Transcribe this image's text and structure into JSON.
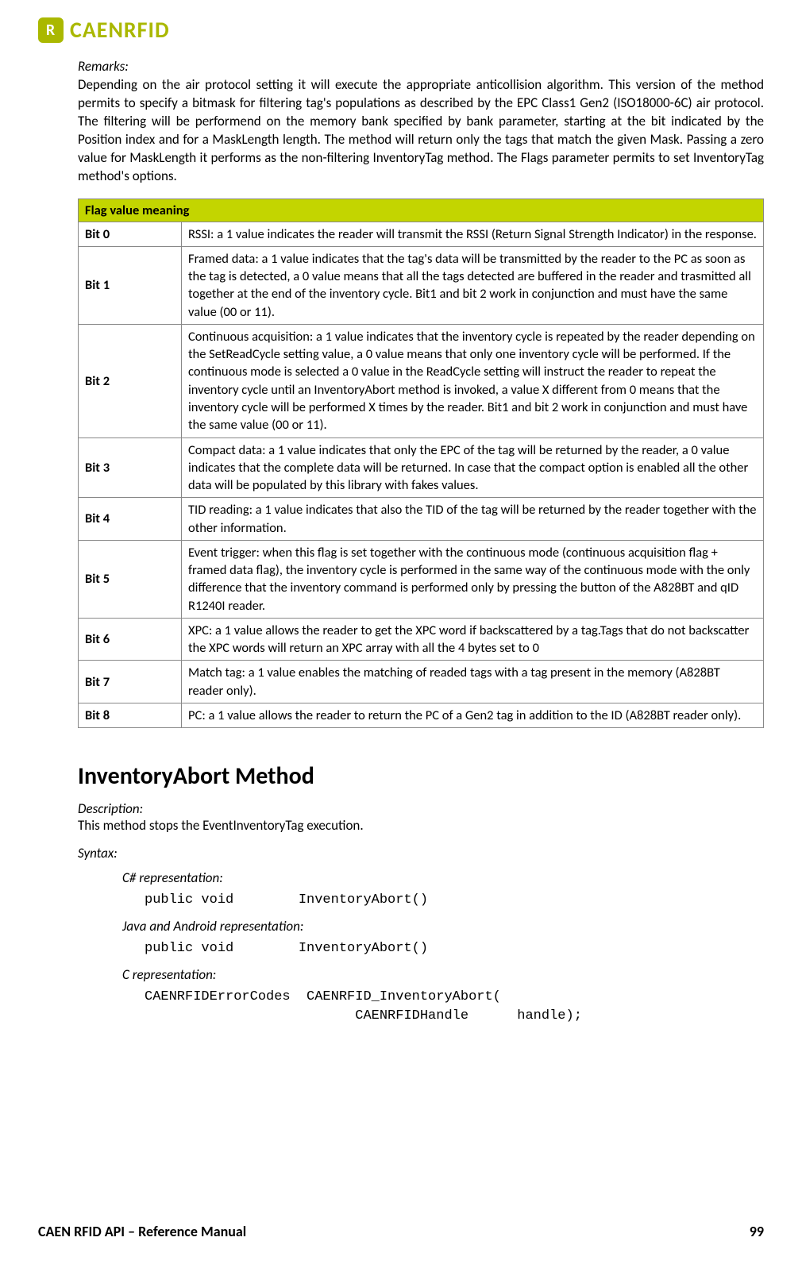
{
  "logo": {
    "text": "CAENRFID"
  },
  "remarks": {
    "label": "Remarks:",
    "text": "Depending on the air protocol setting it will execute the appropriate anticollision algorithm. This version of the method permits to specify a bitmask for filtering tag's populations as described by the EPC Class1 Gen2 (ISO18000-6C) air protocol. The filtering will be performend on the memory bank specified by bank parameter, starting at the bit indicated by the Position index and for a MaskLength length. The method will return only the tags that match the given Mask. Passing a zero value for MaskLength it performs as the non-filtering InventoryTag method. The Flags parameter permits to set InventoryTag method's options."
  },
  "table": {
    "header": "Flag value meaning",
    "rows": [
      {
        "bit": "Bit 0",
        "desc": "RSSI: a 1 value indicates the reader will transmit the RSSI (Return Signal Strength Indicator) in the response."
      },
      {
        "bit": "Bit 1",
        "desc": "Framed data: a 1 value indicates that the tag's data will be transmitted by the reader to the PC as soon as the tag is detected, a 0 value means that all the tags detected are buffered in the reader and trasmitted all together at the end of the inventory cycle.\nBit1 and bit 2 work in conjunction and must have the same value (00 or 11)."
      },
      {
        "bit": "Bit 2",
        "desc": "Continuous acquisition: a 1 value indicates that the inventory cycle is repeated by the reader depending on the SetReadCycle setting value, a 0 value means that only one inventory cycle will be performed. If the continuous mode is selected a 0 value in the ReadCycle setting will instruct the reader to repeat the inventory cycle until an InventoryAbort method is invoked, a value X different from 0 means that the inventory cycle will be performed X times by the reader.\nBit1 and bit 2 work in conjunction and must have the same value (00 or 11)."
      },
      {
        "bit": "Bit 3",
        "desc": "Compact data: a 1 value indicates that only the EPC of the tag will be returned by the reader, a 0 value indicates that the complete data will be returned. In case that the compact option is enabled all the other data will be populated by this library with fakes values."
      },
      {
        "bit": "Bit 4",
        "desc": "TID reading: a 1 value indicates that also the TID of the tag will be returned by the reader together with the other information."
      },
      {
        "bit": "Bit 5",
        "desc": "Event trigger: when this flag is set together with the continuous mode (continuous acquisition flag + framed data flag), the inventory cycle is performed in the same way of the continuous mode with the only difference that the inventory command is performed only by pressing the button of the A828BT and qID R1240I reader."
      },
      {
        "bit": "Bit 6",
        "desc": "XPC: a 1 value allows the reader to get the XPC word if backscattered by a tag.Tags that do not backscatter the XPC words will return an XPC array with all the 4 bytes set to 0"
      },
      {
        "bit": "Bit 7",
        "desc": "Match tag: a 1 value enables the matching of readed tags with a tag present in the memory (A828BT reader only)."
      },
      {
        "bit": "Bit 8",
        "desc": "PC: a 1 value allows the reader to return the PC of a Gen2 tag in addition to the ID (A828BT reader only)."
      }
    ]
  },
  "method": {
    "title": "InventoryAbort Method",
    "descLabel": "Description:",
    "descText": "This method stops the EventInventoryTag execution.",
    "syntaxLabel": "Syntax:",
    "repr": [
      {
        "label": "C# representation:",
        "code": "public void        InventoryAbort()"
      },
      {
        "label": "Java and Android representation:",
        "code": "public void        InventoryAbort()"
      },
      {
        "label": "C representation:",
        "code": "CAENRFIDErrorCodes  CAENRFID_InventoryAbort(\n                          CAENRFIDHandle      handle);"
      }
    ]
  },
  "footer": {
    "left": "CAEN RFID API – Reference Manual",
    "right": "99"
  }
}
